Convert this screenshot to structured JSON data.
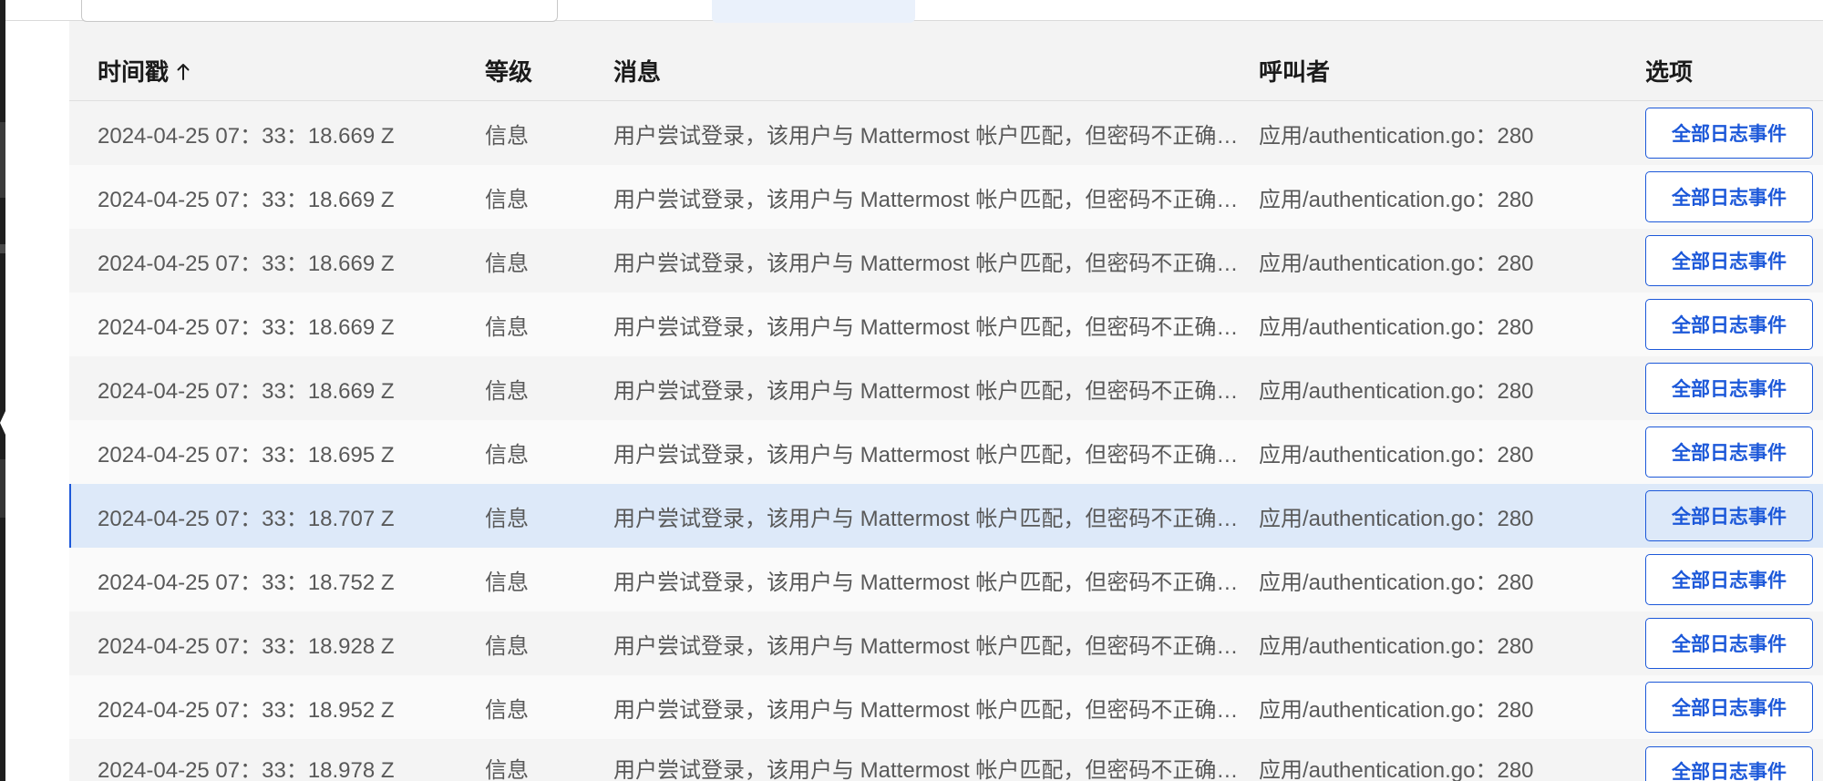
{
  "colors": {
    "accent": "#1c58d9",
    "header_bg": "#f3f3f3",
    "row_odd_bg": "#f4f4f4",
    "row_even_bg": "#fafafa",
    "selected_row_bg": "#dde9f9",
    "text": "#595959",
    "header_text": "#1b1b1b"
  },
  "table": {
    "columns": [
      {
        "label": "时间戳",
        "sort_icon": "arrow-up-icon"
      },
      {
        "label": "等级"
      },
      {
        "label": "消息"
      },
      {
        "label": "呼叫者"
      },
      {
        "label": "选项"
      }
    ],
    "rows": [
      {
        "timestamp": "2024-04-25 07：33：18.669 Z",
        "level": "信息",
        "message": "用户尝试登录，该用户与 Mattermost 帐户匹配，但密码不正确…",
        "caller": "应用/authentication.go：280",
        "action": "全部日志事件",
        "selected": false
      },
      {
        "timestamp": "2024-04-25 07：33：18.669 Z",
        "level": "信息",
        "message": "用户尝试登录，该用户与 Mattermost 帐户匹配，但密码不正确…",
        "caller": "应用/authentication.go：280",
        "action": "全部日志事件",
        "selected": false
      },
      {
        "timestamp": "2024-04-25 07：33：18.669 Z",
        "level": "信息",
        "message": "用户尝试登录，该用户与 Mattermost 帐户匹配，但密码不正确…",
        "caller": "应用/authentication.go：280",
        "action": "全部日志事件",
        "selected": false
      },
      {
        "timestamp": "2024-04-25 07：33：18.669 Z",
        "level": "信息",
        "message": "用户尝试登录，该用户与 Mattermost 帐户匹配，但密码不正确…",
        "caller": "应用/authentication.go：280",
        "action": "全部日志事件",
        "selected": false
      },
      {
        "timestamp": "2024-04-25 07：33：18.669 Z",
        "level": "信息",
        "message": "用户尝试登录，该用户与 Mattermost 帐户匹配，但密码不正确…",
        "caller": "应用/authentication.go：280",
        "action": "全部日志事件",
        "selected": false
      },
      {
        "timestamp": "2024-04-25 07：33：18.695 Z",
        "level": "信息",
        "message": "用户尝试登录，该用户与 Mattermost 帐户匹配，但密码不正确…",
        "caller": "应用/authentication.go：280",
        "action": "全部日志事件",
        "selected": false
      },
      {
        "timestamp": "2024-04-25 07：33：18.707 Z",
        "level": "信息",
        "message": "用户尝试登录，该用户与 Mattermost 帐户匹配，但密码不正确…",
        "caller": "应用/authentication.go：280",
        "action": "全部日志事件",
        "selected": true
      },
      {
        "timestamp": "2024-04-25 07：33：18.752 Z",
        "level": "信息",
        "message": "用户尝试登录，该用户与 Mattermost 帐户匹配，但密码不正确…",
        "caller": "应用/authentication.go：280",
        "action": "全部日志事件",
        "selected": false
      },
      {
        "timestamp": "2024-04-25 07：33：18.928 Z",
        "level": "信息",
        "message": "用户尝试登录，该用户与 Mattermost 帐户匹配，但密码不正确…",
        "caller": "应用/authentication.go：280",
        "action": "全部日志事件",
        "selected": false
      },
      {
        "timestamp": "2024-04-25 07：33：18.952 Z",
        "level": "信息",
        "message": "用户尝试登录，该用户与 Mattermost 帐户匹配，但密码不正确…",
        "caller": "应用/authentication.go：280",
        "action": "全部日志事件",
        "selected": false
      },
      {
        "timestamp": "2024-04-25 07：33：18.978 Z",
        "level": "信息",
        "message": "用户尝试登录，该用户与 Mattermost 帐户匹配，但密码不正确…",
        "caller": "应用/authentication.go：280",
        "action": "全部日志事件",
        "selected": false
      }
    ]
  }
}
